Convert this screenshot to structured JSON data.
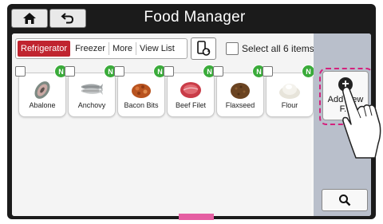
{
  "header": {
    "title": "Food Manager",
    "home_icon": "home-icon",
    "back_icon": "back-arrow-icon"
  },
  "tabs": [
    {
      "label": "Refrigerator",
      "active": true
    },
    {
      "label": "Freezer",
      "active": false
    },
    {
      "label": "More",
      "active": false
    },
    {
      "label": "View List",
      "active": false
    }
  ],
  "toolbar": {
    "sync_icon": "phone-sync-icon",
    "select_all_label": "Select all 6 items"
  },
  "items": [
    {
      "label": "Abalone",
      "badge": "N",
      "icon": "abalone-icon"
    },
    {
      "label": "Anchovy",
      "badge": "N",
      "icon": "anchovy-icon"
    },
    {
      "label": "Bacon Bits",
      "badge": "N",
      "icon": "bacon-bits-icon"
    },
    {
      "label": "Beef Filet",
      "badge": "N",
      "icon": "beef-filet-icon"
    },
    {
      "label": "Flaxseed",
      "badge": "N",
      "icon": "flaxseed-icon"
    },
    {
      "label": "Flour",
      "badge": "N",
      "icon": "flour-icon"
    }
  ],
  "side": {
    "add_label": "Add New F...",
    "add_icon": "plus-circle-icon",
    "search_icon": "search-icon"
  },
  "colors": {
    "active_tab": "#c0242f",
    "badge": "#3aab3a",
    "highlight": "#d4217d",
    "side_panel": "#b9bfcb"
  }
}
